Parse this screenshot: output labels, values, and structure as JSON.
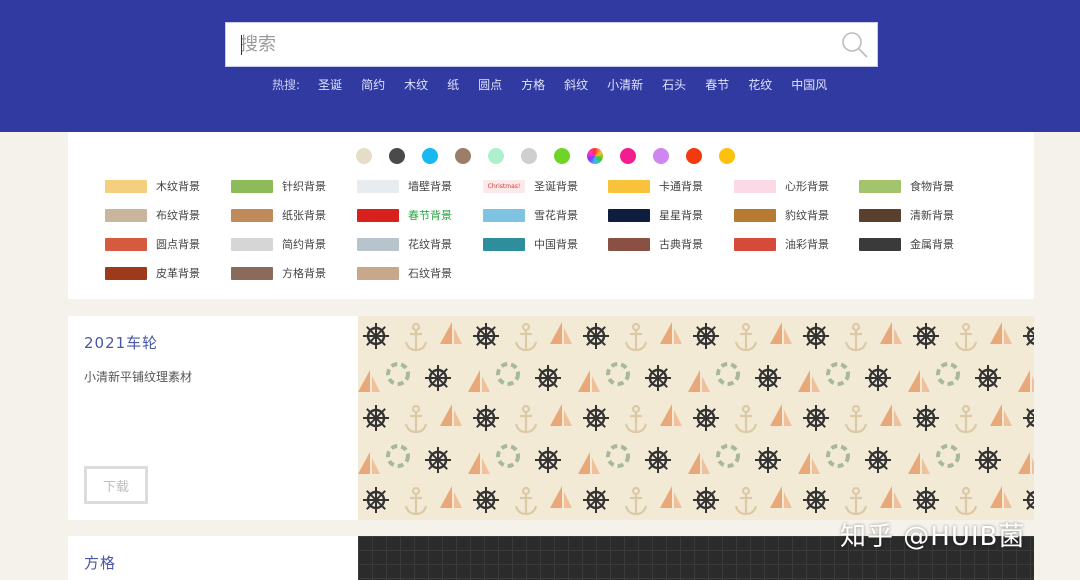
{
  "search": {
    "placeholder": "搜索"
  },
  "hot": {
    "label": "热搜:",
    "terms": [
      "圣诞",
      "简约",
      "木纹",
      "纸",
      "圆点",
      "方格",
      "斜纹",
      "小清新",
      "石头",
      "春节",
      "花纹",
      "中国风"
    ]
  },
  "colors": [
    "#e6ddc6",
    "#4a4a4a",
    "#18b8f0",
    "#9c7e68",
    "#aef0cc",
    "#cfcfcf",
    "#6ed42a",
    "rainbow",
    "#f21d8f",
    "#cf86ee",
    "#f23a0e",
    "#fbc10b"
  ],
  "categories": [
    {
      "label": "木纹背景",
      "color": "#f3cf7e"
    },
    {
      "label": "针织背景",
      "color": "#8dbb5a"
    },
    {
      "label": "墙壁背景",
      "color": "#e9ecef"
    },
    {
      "label": "圣诞背景",
      "color": "#fde9ea",
      "swatch_text": "Christmas!"
    },
    {
      "label": "卡通背景",
      "color": "#f8c23a"
    },
    {
      "label": "心形背景",
      "color": "#fbd9e6"
    },
    {
      "label": "食物背景",
      "color": "#a3c46a"
    },
    {
      "label": "布纹背景",
      "color": "#c9b59c"
    },
    {
      "label": "纸张背景",
      "color": "#c08a5a"
    },
    {
      "label": "春节背景",
      "color": "#d8201c",
      "active": true
    },
    {
      "label": "雪花背景",
      "color": "#7ec4e2"
    },
    {
      "label": "星星背景",
      "color": "#0e1e3e"
    },
    {
      "label": "豹纹背景",
      "color": "#b77a33"
    },
    {
      "label": "清新背景",
      "color": "#5a3f2e"
    },
    {
      "label": "圆点背景",
      "color": "#d65a40"
    },
    {
      "label": "简约背景",
      "color": "#d6d6d6"
    },
    {
      "label": "花纹背景",
      "color": "#b8c4cc"
    },
    {
      "label": "中国背景",
      "color": "#2f8e9c"
    },
    {
      "label": "古典背景",
      "color": "#8a5044"
    },
    {
      "label": "油彩背景",
      "color": "#d64a3a"
    },
    {
      "label": "金属背景",
      "color": "#3a3a3a"
    },
    {
      "label": "皮革背景",
      "color": "#9c3a1c"
    },
    {
      "label": "方格背景",
      "color": "#8a6a5a"
    },
    {
      "label": "石纹背景",
      "color": "#c8a88a"
    }
  ],
  "cards": [
    {
      "title": "2021车轮",
      "desc": "小清新平铺纹理素材",
      "button": "下载"
    },
    {
      "title": "方格"
    }
  ],
  "watermark": "知乎 @HUIB菌"
}
